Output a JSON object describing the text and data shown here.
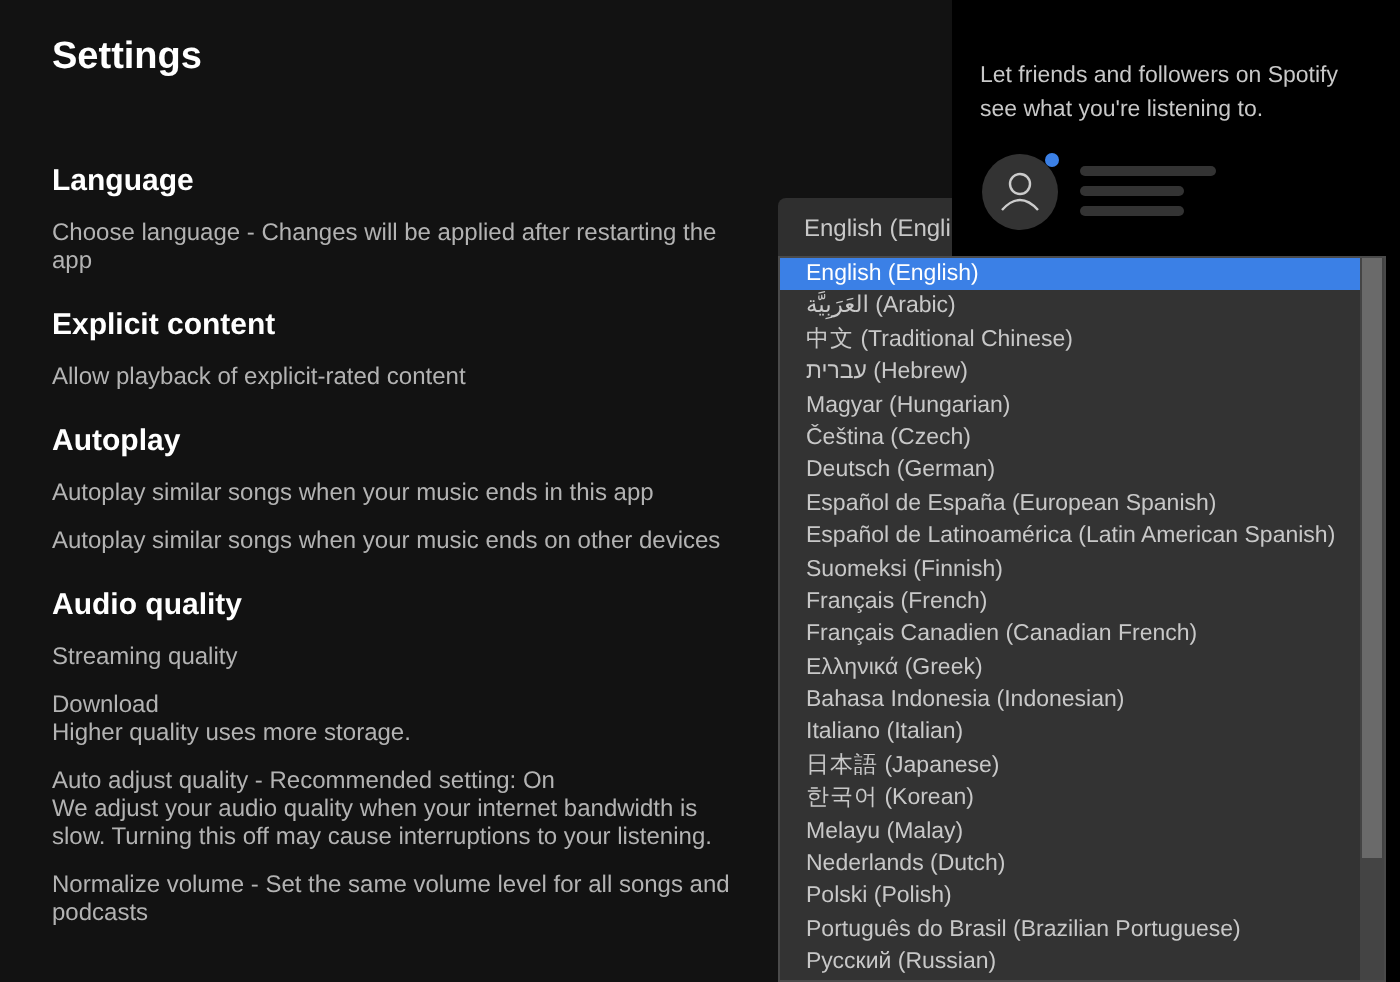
{
  "title": "Settings",
  "sections": [
    {
      "heading": "Language",
      "items": [
        {
          "label": "Choose language - Changes will be applied after restarting the app"
        }
      ]
    },
    {
      "heading": "Explicit content",
      "items": [
        {
          "label": "Allow playback of explicit-rated content"
        }
      ]
    },
    {
      "heading": "Autoplay",
      "items": [
        {
          "label": "Autoplay similar songs when your music ends in this app"
        },
        {
          "label": "Autoplay similar songs when your music ends on other devices"
        }
      ]
    },
    {
      "heading": "Audio quality",
      "items": [
        {
          "label": "Streaming quality"
        },
        {
          "label": "Download",
          "description": "Higher quality uses more storage."
        },
        {
          "label": "Auto adjust quality - Recommended setting: On",
          "description": "We adjust your audio quality when your internet bandwidth is slow. Turning this off may cause interruptions to your listening."
        },
        {
          "label": "Normalize volume - Set the same volume level for all songs and podcasts"
        }
      ]
    }
  ],
  "language_select": {
    "value": "English (Engli",
    "options": [
      {
        "label": "English (English)",
        "selected": true
      },
      {
        "label": "العَرَبِيَّة (Arabic)",
        "selected": false
      },
      {
        "label": "中文 (Traditional Chinese)",
        "selected": false
      },
      {
        "label": "עברית (Hebrew)",
        "selected": false
      },
      {
        "label": "Magyar (Hungarian)",
        "selected": false
      },
      {
        "label": "Čeština (Czech)",
        "selected": false
      },
      {
        "label": "Deutsch (German)",
        "selected": false
      },
      {
        "label": "Español de España (European Spanish)",
        "selected": false
      },
      {
        "label": "Español de Latinoamérica (Latin American Spanish)",
        "selected": false
      },
      {
        "label": "Suomeksi (Finnish)",
        "selected": false
      },
      {
        "label": "Français (French)",
        "selected": false
      },
      {
        "label": "Français Canadien (Canadian French)",
        "selected": false
      },
      {
        "label": "Ελληνικά (Greek)",
        "selected": false
      },
      {
        "label": "Bahasa Indonesia (Indonesian)",
        "selected": false
      },
      {
        "label": "Italiano (Italian)",
        "selected": false
      },
      {
        "label": "日本語 (Japanese)",
        "selected": false
      },
      {
        "label": "한국어 (Korean)",
        "selected": false
      },
      {
        "label": "Melayu (Malay)",
        "selected": false
      },
      {
        "label": "Nederlands (Dutch)",
        "selected": false
      },
      {
        "label": "Polski (Polish)",
        "selected": false
      },
      {
        "label": "Português do Brasil (Brazilian Portuguese)",
        "selected": false
      },
      {
        "label": "Русский (Russian)",
        "selected": false
      }
    ]
  },
  "friend_activity": {
    "text": "Let friends and followers on Spotify see what you're listening to."
  }
}
